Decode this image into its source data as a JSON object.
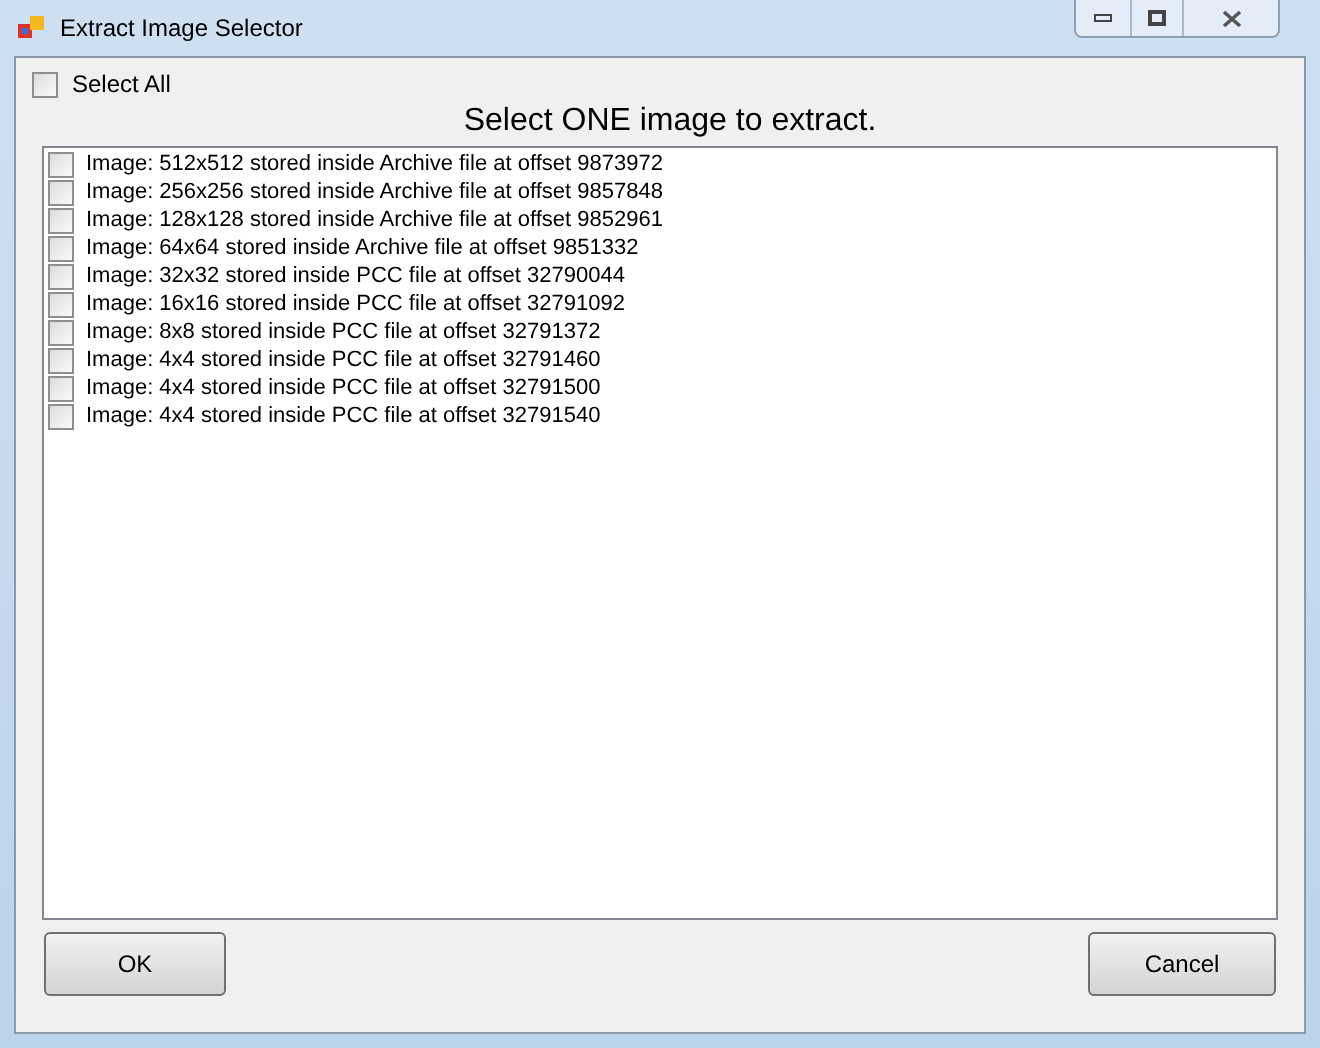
{
  "window": {
    "title": "Extract Image Selector"
  },
  "select_all": {
    "label": "Select All",
    "checked": false
  },
  "heading": "Select ONE image to extract.",
  "images": [
    {
      "label": "Image: 512x512 stored inside Archive file at offset 9873972",
      "checked": false
    },
    {
      "label": "Image: 256x256 stored inside Archive file at offset 9857848",
      "checked": false
    },
    {
      "label": "Image: 128x128 stored inside Archive file at offset 9852961",
      "checked": false
    },
    {
      "label": "Image: 64x64 stored inside Archive file at offset 9851332",
      "checked": false
    },
    {
      "label": "Image: 32x32 stored inside PCC file at offset 32790044",
      "checked": false
    },
    {
      "label": "Image: 16x16 stored inside PCC file at offset 32791092",
      "checked": false
    },
    {
      "label": "Image: 8x8 stored inside PCC file at offset 32791372",
      "checked": false
    },
    {
      "label": "Image: 4x4 stored inside PCC file at offset 32791460",
      "checked": false
    },
    {
      "label": "Image: 4x4 stored inside PCC file at offset 32791500",
      "checked": false
    },
    {
      "label": "Image: 4x4 stored inside PCC file at offset 32791540",
      "checked": false
    }
  ],
  "buttons": [
    "OK",
    "Cancel"
  ]
}
